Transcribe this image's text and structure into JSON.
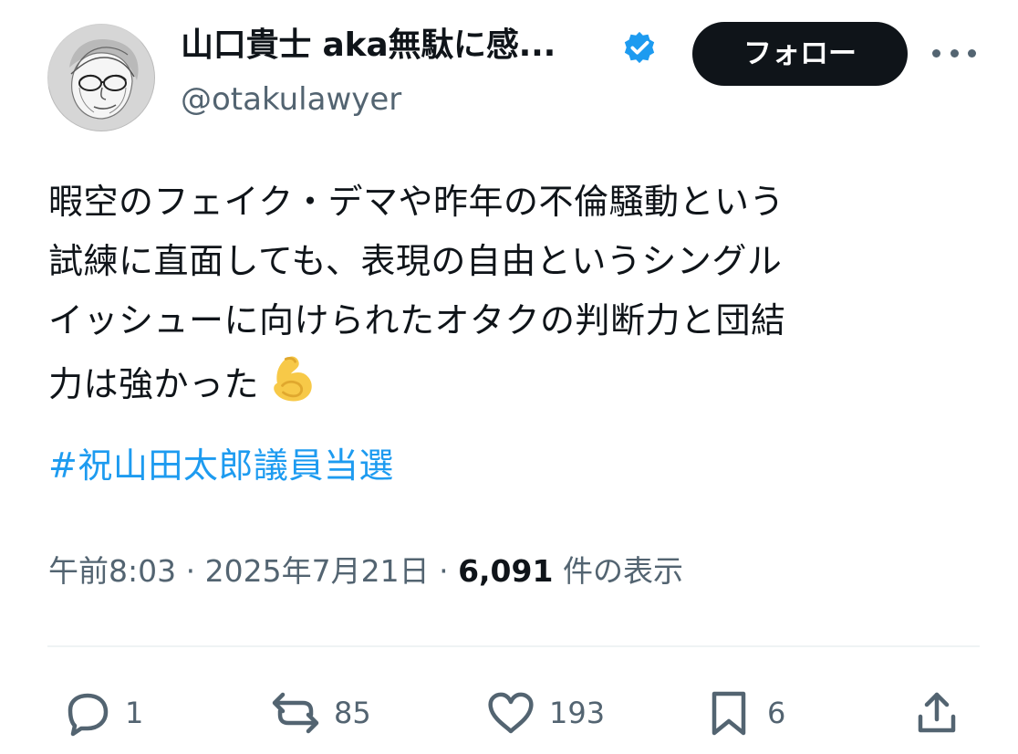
{
  "user": {
    "display_name": "山口貴士 aka無駄に感...",
    "handle": "@otakulawyer",
    "verified_color": "#1d9bf0"
  },
  "header": {
    "follow_label": "フォロー",
    "more_icon": "more-horizontal-icon"
  },
  "tweet": {
    "text_lines": [
      "暇空のフェイク・デマや昨年の不倫騒動という",
      "試練に直面しても、表現の自由というシングル",
      "イッシューに向けられたオタクの判断力と団結",
      "力は強かった"
    ],
    "emoji": "💪",
    "hashtag": "#祝山田太郎議員当選"
  },
  "meta": {
    "time": "午前8:03",
    "separator": " · ",
    "date": "2025年7月21日",
    "views_count": "6,091",
    "views_suffix": "件の表示"
  },
  "actions": {
    "reply_count": "1",
    "repost_count": "85",
    "like_count": "193",
    "bookmark_count": "6"
  },
  "colors": {
    "text": "#0f1419",
    "secondary": "#536471",
    "link": "#1d9bf0",
    "divider": "#eff3f4"
  }
}
